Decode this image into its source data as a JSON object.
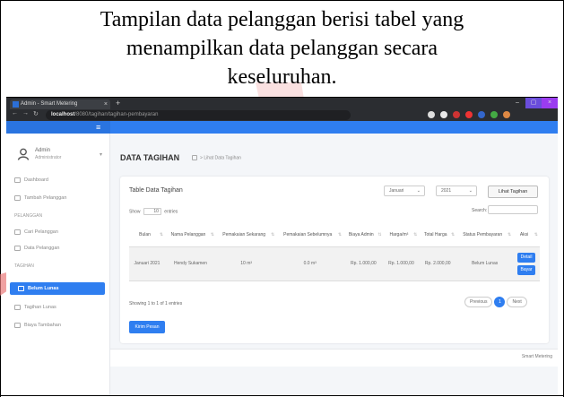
{
  "caption": {
    "line1": "Tampilan data pelanggan berisi tabel yang",
    "line2": "menampilkan data pelanggan secara",
    "line3": "keseluruhan."
  },
  "colors": {
    "primary": "#2f7ef0",
    "decoration": "#f2b7b7"
  },
  "browser": {
    "tab_title": "Admin - Smart Metering",
    "url_host": "localhost",
    "url_path": "/8080/tagihan/tagihan-pembayaran"
  },
  "sidebar": {
    "user": {
      "name": "Admin",
      "role": "Administrator"
    },
    "items": [
      {
        "label": "Dashboard",
        "icon": "dashboard-icon"
      },
      {
        "label": "Tambah Pelanggan",
        "icon": "add-user-icon"
      }
    ],
    "section_pelanggan": "PELANGGAN",
    "pelanggan_items": [
      {
        "label": "Cari Pelanggan",
        "icon": "search-icon"
      },
      {
        "label": "Data Pelanggan",
        "icon": "list-icon"
      }
    ],
    "section_tagihan": "TAGIHAN",
    "tagihan_items": [
      {
        "label": "Belum Lunas",
        "icon": "bill-icon",
        "active": true
      },
      {
        "label": "Tagihan Lunas",
        "icon": "check-icon"
      },
      {
        "label": "Biaya Tambahan",
        "icon": "plus-icon"
      }
    ]
  },
  "page": {
    "title": "DATA TAGIHAN",
    "breadcrumb": "Lihat Data Tagihan"
  },
  "card": {
    "title": "Table Data Tagihan",
    "bulan_select": "Januari",
    "tahun_select": "2021",
    "lihat_button": "Lihat Tagihan",
    "show_label": "Show",
    "show_value": "10",
    "entries_label": "entries",
    "search_label": "Search:",
    "columns": [
      "Bulan",
      "Nama Pelanggan",
      "Pemakaian Sekarang",
      "Pemakaian Sebelumnya",
      "Biaya Admin",
      "Harga/m³",
      "Total Harga",
      "Status Pembayaran",
      "Aksi"
    ],
    "rows": [
      [
        "Januari 2021",
        "Hendy Sukamen",
        "10 m³",
        "0.0 m³",
        "Rp. 1.000,00",
        "Rp. 1.000,00",
        "Rp. 2.000,00",
        "Belum Lunas"
      ]
    ],
    "detail_button": "Detail",
    "bayar_button": "Bayar",
    "info": "Showing 1 to 1 of 1 entries",
    "pager": {
      "previous": "Previous",
      "current": "1",
      "next": "Next"
    },
    "kirim_button": "Kirim Pesan"
  },
  "footer": {
    "text": "Smart Metering"
  }
}
